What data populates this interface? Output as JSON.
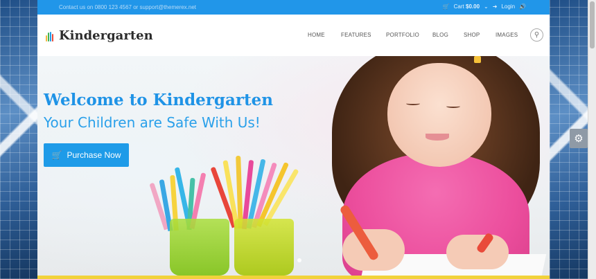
{
  "topbar": {
    "contact": "Contact us on 0800 123 4567 or support@themerex.net",
    "cart_label": "Cart",
    "cart_amount": "$0.00",
    "login": "Login"
  },
  "logo": {
    "text": "Kindergarten"
  },
  "nav": {
    "items": [
      {
        "label": "HOME"
      },
      {
        "label": "FEATURES"
      },
      {
        "label": "PORTFOLIO"
      },
      {
        "label": "BLOG"
      },
      {
        "label": "SHOP"
      },
      {
        "label": "IMAGES"
      }
    ]
  },
  "hero": {
    "title": "Welcome to Kindergarten",
    "subtitle": "Your Children are Safe With Us!",
    "button_label": "Purchase Now"
  },
  "icons": {
    "cart": "cart-icon",
    "login": "login-icon",
    "search": "search-icon",
    "settings": "gear-icon",
    "volume": "volume-icon"
  },
  "colors": {
    "accent": "#1e9be8",
    "topbar": "#2196e9",
    "bottom_accent": "#f1d23a"
  }
}
